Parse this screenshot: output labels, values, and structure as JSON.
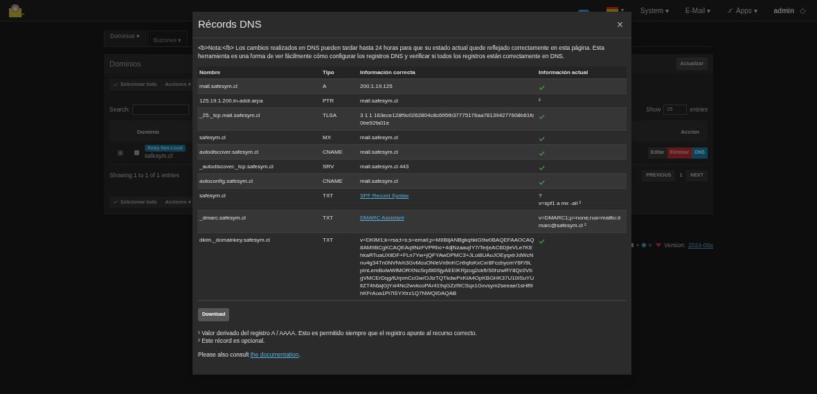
{
  "navbar": {
    "menus": [
      {
        "label": "System",
        "caret": "▾"
      },
      {
        "label": "E-Mail",
        "caret": "▾"
      },
      {
        "label": "Apps",
        "caret": "▾"
      }
    ],
    "user": "admin",
    "language_caret": "▾"
  },
  "tabs": [
    {
      "label": "Dominios ▾",
      "selected": true
    },
    {
      "label": "Buzones ▾",
      "selected": false
    }
  ],
  "panel": {
    "title": "Dominios",
    "refresh": "Actualizar",
    "select_all": "Selecionar todo",
    "actions": "Acciones ▾",
    "search_label": "Search:",
    "show": "Show",
    "page_size": "25",
    "entries": "entries",
    "columns": [
      "Dominio",
      "Acción"
    ],
    "rows": [
      {
        "badge": "Relay Non-Local",
        "domain": "safesym.cl",
        "checked": false,
        "buttons": [
          {
            "kind": "edit",
            "label": "Editar"
          },
          {
            "kind": "delete",
            "label": "Eliminar"
          },
          {
            "kind": "dns",
            "label": "DNS"
          }
        ]
      }
    ],
    "info": "Showing 1 to 1 of 1 entries",
    "pagination": [
      "PREVIOUS",
      "1",
      "NEXT"
    ],
    "bottom_select_all": "Selecionar todo",
    "bottom_actions": "Acciones ▾"
  },
  "footer": {
    "version_label": "Version:",
    "version": "2024-08a"
  },
  "modal": {
    "title": "Récords DNS",
    "close": "×",
    "note": "<b>Nota:</b> Los cambios realizados en DNS pueden tardar hasta 24 horas para que su estado actual quede reflejado correctamente en esta página. Esta herramienta es una forma de ver fácilmente cómo configurar los registros DNS y verificar si todos los registros están correctamente en DNS.",
    "columns": [
      "Nombre",
      "Tipo",
      "Información correcta",
      "Información actual"
    ],
    "rows": [
      {
        "name": "mail.safesym.cl",
        "type": "A",
        "correct": "200.1.19.125",
        "correct_is_link": false,
        "ok": true,
        "actual": []
      },
      {
        "name": "125.19.1.200.in-addr.arpa",
        "type": "PTR",
        "correct": "mail.safesym.cl",
        "correct_is_link": false,
        "ok": false,
        "actual": [
          "²"
        ]
      },
      {
        "name": "_25._tcp.mail.safesym.cl",
        "type": "TLSA",
        "correct": "3 1 1 163ece128f9c0262804c8c695fb37775176aa781394277608b61fc0be92fa01e",
        "correct_is_link": false,
        "ok": true,
        "actual": []
      },
      {
        "name": "safesym.cl",
        "type": "MX",
        "correct": "mail.safesym.cl",
        "correct_is_link": false,
        "ok": true,
        "actual": []
      },
      {
        "name": "autodiscover.safesym.cl",
        "type": "CNAME",
        "correct": "mail.safesym.cl",
        "correct_is_link": false,
        "ok": true,
        "actual": []
      },
      {
        "name": "_autodiscover._tcp.safesym.cl",
        "type": "SRV",
        "correct": "mail.safesym.cl 443",
        "correct_is_link": false,
        "ok": true,
        "actual": []
      },
      {
        "name": "autoconfig.safesym.cl",
        "type": "CNAME",
        "correct": "mail.safesym.cl",
        "correct_is_link": false,
        "ok": true,
        "actual": []
      },
      {
        "name": "safesym.cl",
        "type": "TXT",
        "correct": "SPF Record Syntax",
        "correct_is_link": true,
        "ok": false,
        "actual": [
          "?",
          "v=spf1 a mx -all ²"
        ]
      },
      {
        "name": "_dmarc.safesym.cl",
        "type": "TXT",
        "correct": "DMARC Assistant",
        "correct_is_link": true,
        "ok": false,
        "actual": [
          "v=DMARC1;p=none;rua=mailto:dmarc@safesym.cl ²"
        ]
      },
      {
        "name": "dkim._domainkey.safesym.cl",
        "type": "TXT",
        "correct": "v=DKIM1;k=rsa;t=s;s=email;p=MIIBIjANBgkqhkiG9w0BAQEFAAOCAQ8AMIIBCgKCAQEAq9NzFVPRbc+4djNzaaujIY7/TerjeAC6DjIeVLe7KEhkaRTuaUXiiDF+FLn7Yw+jQFYAwDPMC3+JLoi8UAuJOEyqxirJdWcNnu4g34Tn0NVNvh3GvMcuONleVn9nKCn9qfoKxCxr8FccbycmY6F/9LpInLemBolwWlMORXNcSrp5t0SjyAEEIKRjzog2ckft/S0hzwRY8Qc0VbgVMCErDqg/tUrpmCcGw/OJizTQTkdwPxKIA4OpKBGHK37U10ISuYUlIZT4h6ajGjYxi4Nc2wvkcoPAr419qGZzf9CSqx1Gxvsym2seeae/1sHlf9hKFrAoa1Pi7lSYXtrz1Q7NWQIDAQAB",
        "correct_is_link": false,
        "ok": true,
        "actual": []
      }
    ],
    "download": "Download",
    "footnotes": [
      "¹ Valor derivado del registro A / AAAA. Esto es permitido siempre que el registro apunte al recurso correcto.",
      "² Este récord es opcional."
    ],
    "consult": "Please also consult",
    "consult_link": "the documentation",
    "consult_end": "."
  }
}
